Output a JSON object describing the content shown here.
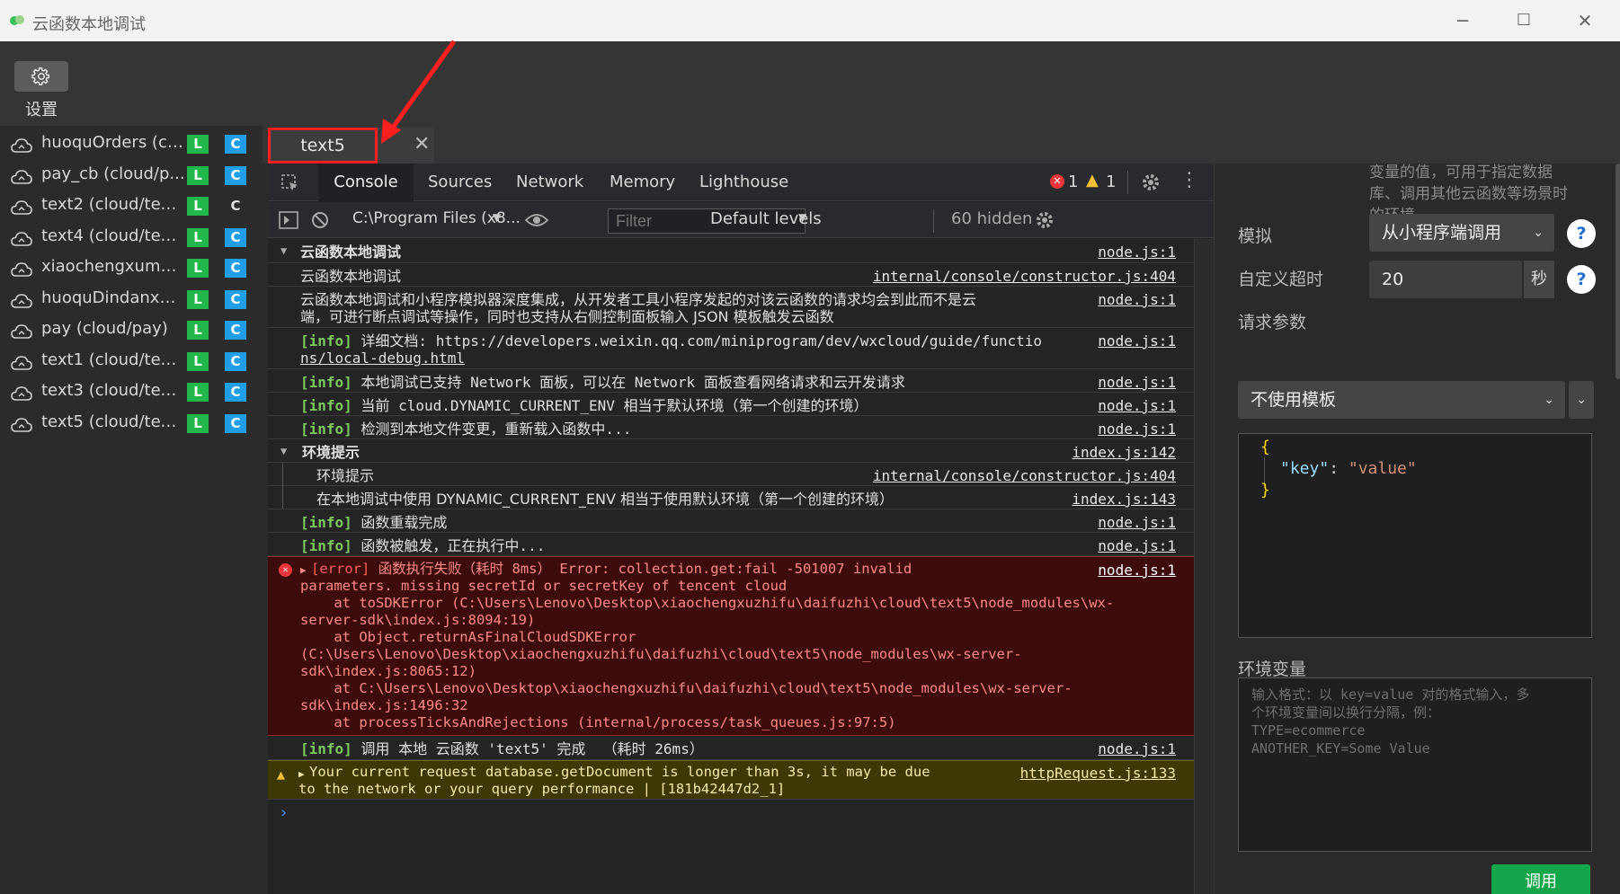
{
  "window": {
    "title": "云函数本地调试",
    "minimize": "─",
    "maximize": "☐",
    "close": "✕"
  },
  "toolbar": {
    "settings_label": "设置"
  },
  "sidebar": {
    "items": [
      {
        "name": "huoquOrders (cl...",
        "l": "L",
        "c": "C",
        "c_plain": false
      },
      {
        "name": "pay_cb (cloud/p...",
        "l": "L",
        "c": "C",
        "c_plain": false
      },
      {
        "name": "text2 (cloud/text2)",
        "l": "L",
        "c": "C",
        "c_plain": true
      },
      {
        "name": "text4 (cloud/text4)",
        "l": "L",
        "c": "C",
        "c_plain": false
      },
      {
        "name": "xiaochengxuma ...",
        "l": "L",
        "c": "C",
        "c_plain": false
      },
      {
        "name": "huoquDindanxq ...",
        "l": "L",
        "c": "C",
        "c_plain": false
      },
      {
        "name": "pay (cloud/pay)",
        "l": "L",
        "c": "C",
        "c_plain": false
      },
      {
        "name": "text1 (cloud/text1)",
        "l": "L",
        "c": "C",
        "c_plain": false
      },
      {
        "name": "text3 (cloud/text3)",
        "l": "L",
        "c": "C",
        "c_plain": false
      },
      {
        "name": "text5 (cloud/text5)",
        "l": "L",
        "c": "C",
        "c_plain": false
      }
    ]
  },
  "tabs": {
    "active": "text5",
    "close": "✕"
  },
  "devtools": {
    "tabs": [
      "Console",
      "Sources",
      "Network",
      "Memory",
      "Lighthouse"
    ],
    "error_count": "1",
    "warning_count": "1",
    "context": "C:\\Program Files (x8...",
    "filter_placeholder": "Filter",
    "levels": "Default levels",
    "hidden": "60 hidden"
  },
  "console": {
    "rows": [
      {
        "msg": "云函数本地调试",
        "src": "node.js:1"
      },
      {
        "msg": "云函数本地调试",
        "src": "internal/console/constructor.js:404"
      },
      {
        "msg1": "云函数本地调试和小程序模拟器深度集成，从开发者工具小程序发起的对该云函数的请求均会到此而不是云",
        "msg2": "端，可进行断点调试等操作，同时也支持从右侧控制面板输入 JSON 模板触发云函数",
        "src": "node.js:1"
      },
      {
        "tag": "[info]",
        "msg1": " 详细文档: https://developers.weixin.qq.com/miniprogram/dev/wxcloud/guide/functio",
        "msg2": "ns/local-debug.html",
        "src": "node.js:1"
      },
      {
        "tag": "[info]",
        "msg": " 本地调试已支持 Network 面板，可以在 Network 面板查看网络请求和云开发请求",
        "src": "node.js:1"
      },
      {
        "tag": "[info]",
        "msg": " 当前 cloud.DYNAMIC_CURRENT_ENV 相当于默认环境（第一个创建的环境）",
        "src": "node.js:1"
      },
      {
        "tag": "[info]",
        "msg": " 检测到本地文件变更，重新载入函数中...",
        "src": "node.js:1"
      },
      {
        "msg": "环境提示",
        "src": "index.js:142"
      },
      {
        "msg": "环境提示",
        "src": "internal/console/constructor.js:404"
      },
      {
        "msg": "在本地调试中使用 DYNAMIC_CURRENT_ENV 相当于使用默认环境（第一个创建的环境）",
        "src": "index.js:143"
      },
      {
        "tag": "[info]",
        "msg": " 函数重载完成",
        "src": "node.js:1"
      },
      {
        "tag": "[info]",
        "msg": " 函数被触发，正在执行中...",
        "src": "node.js:1"
      },
      {
        "tag": "[error]",
        "lines": [
          " 函数执行失败（耗时 8ms） Error: collection.get:fail -501007 invalid",
          "parameters. missing secretId or secretKey of tencent cloud",
          "    at toSDKError (C:\\Users\\Lenovo\\Desktop\\xiaochengxuzhifu\\daifuzhi\\cloud\\text5\\node_modules\\wx-",
          "server-sdk\\index.js:8094:19)",
          "    at Object.returnAsFinalCloudSDKError",
          "(C:\\Users\\Lenovo\\Desktop\\xiaochengxuzhifu\\daifuzhi\\cloud\\text5\\node_modules\\wx-server-",
          "sdk\\index.js:8065:12)",
          "    at C:\\Users\\Lenovo\\Desktop\\xiaochengxuzhifu\\daifuzhi\\cloud\\text5\\node_modules\\wx-server-",
          "sdk\\index.js:1496:32",
          "    at processTicksAndRejections (internal/process/task_queues.js:97:5)"
        ],
        "src": "node.js:1"
      },
      {
        "tag": "[info]",
        "msg": " 调用 本地 云函数 'text5' 完成  （耗时 26ms）",
        "src": "node.js:1"
      },
      {
        "msg1": "Your current request database.getDocument is longer than 3s, it may be due",
        "msg2": "to the network or your query performance | [181b42447d2_1]",
        "src": "httpRequest.js:133"
      }
    ],
    "prompt": "›"
  },
  "right_panel": {
    "hint_lines": [
      "变量的值，可用于指定数据",
      "库、调用其他云函数等场景时",
      "的环境。"
    ],
    "mode_label": "模拟",
    "mode_value": "从小程序端调用",
    "timeout_label": "自定义超时",
    "timeout_value": "20",
    "timeout_unit": "秒",
    "params_label": "请求参数",
    "template_value": "不使用模板",
    "json_open": "{",
    "json_key": "\"key\"",
    "json_colon": ": ",
    "json_value": "\"value\"",
    "json_close": "}",
    "env_label": "环境变量",
    "env_placeholder": [
      "输入格式：以 key=value 对的格式输入，多",
      "个环境变量间以换行分隔，例：",
      "TYPE=ecommerce",
      "ANOTHER_KEY=Some Value"
    ],
    "invoke_button": "调用",
    "help": "?"
  },
  "colors": {
    "accent_red": "#ff1f1f",
    "badge_l": "#21b74a",
    "badge_c": "#1e9fe8",
    "invoke": "#14a64a"
  }
}
